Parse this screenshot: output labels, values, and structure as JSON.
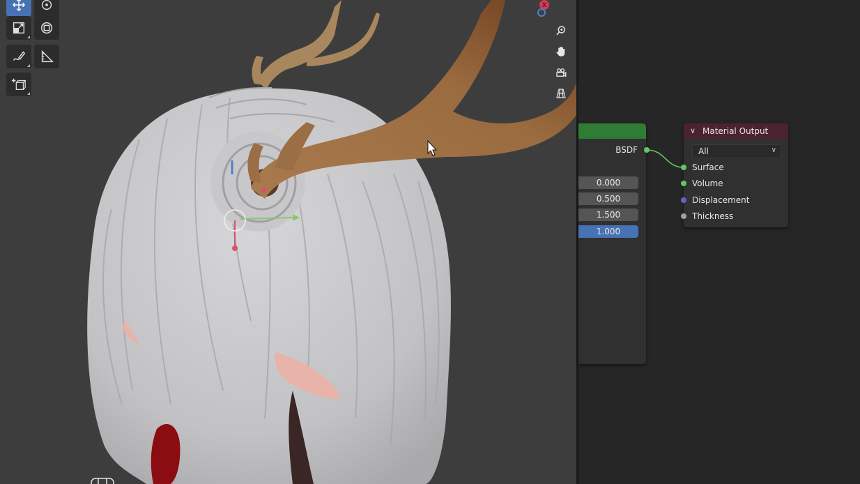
{
  "toolbar": {
    "tools": [
      {
        "name": "move",
        "active": true
      },
      {
        "name": "rotate",
        "active": false
      },
      {
        "name": "scale",
        "active": false
      },
      {
        "name": "transform",
        "active": false
      },
      {
        "name": "annotate",
        "active": false
      },
      {
        "name": "measure",
        "active": false
      },
      {
        "name": "add-cube",
        "active": false
      }
    ]
  },
  "navigation_gizmo": {
    "axis_label": "X",
    "buttons": [
      "zoom-icon",
      "hand-pan-icon",
      "camera-icon",
      "grid-perspective-icon"
    ]
  },
  "node_editor": {
    "principled_bsdf": {
      "output_socket_label": "BSDF",
      "header_color": "#2f7d34",
      "fields": [
        "0.000",
        "0.500",
        "1.500",
        "1.000"
      ],
      "active_field_index": 3
    },
    "material_output": {
      "title": "Material Output",
      "header_color": "#4b2230",
      "target": "All",
      "inputs": [
        {
          "label": "Surface",
          "color": "#63c763"
        },
        {
          "label": "Volume",
          "color": "#63c763"
        },
        {
          "label": "Displacement",
          "color": "#6363c7"
        },
        {
          "label": "Thickness",
          "color": "#a1a1a1"
        }
      ]
    }
  },
  "colors": {
    "accent": "#4772b3",
    "viewport_bg": "#3d3d3d",
    "node_editor_bg": "#262626"
  }
}
